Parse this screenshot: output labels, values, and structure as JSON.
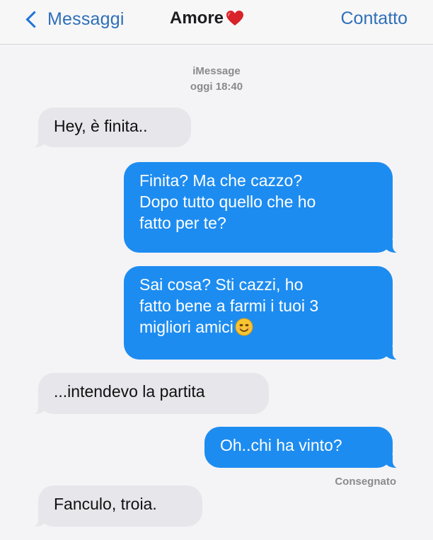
{
  "nav": {
    "back_label": "Messaggi",
    "title": "Amore",
    "title_icon": "red-heart-icon",
    "contact_label": "Contatto",
    "accent_color": "#2f6fb8"
  },
  "thread_header": {
    "service": "iMessage",
    "timestamp": "oggi 18:40"
  },
  "messages": [
    {
      "direction": "incoming",
      "lines": [
        "Hey, è finita.."
      ]
    },
    {
      "direction": "outgoing",
      "lines": [
        "Finita? Ma che cazzo?",
        "Dopo tutto quello che ho",
        "fatto per te?"
      ]
    },
    {
      "direction": "outgoing",
      "lines": [
        "Sai cosa? Sti cazzi, ho",
        "fatto bene a farmi i tuoi 3",
        "migliori amici"
      ],
      "trailing_icon": "smiling-face-emoji-icon"
    },
    {
      "direction": "incoming",
      "lines": [
        "...intendevo la partita"
      ]
    },
    {
      "direction": "outgoing",
      "lines": [
        "Oh..chi ha vinto?"
      ]
    },
    {
      "direction": "incoming",
      "lines": [
        "Fanculo, troia."
      ]
    }
  ],
  "delivery_status": "Consegnato",
  "colors": {
    "incoming_bubble": "#e6e6eb",
    "outgoing_bubble": "#1d8cf0",
    "heart": "#d8232a"
  }
}
